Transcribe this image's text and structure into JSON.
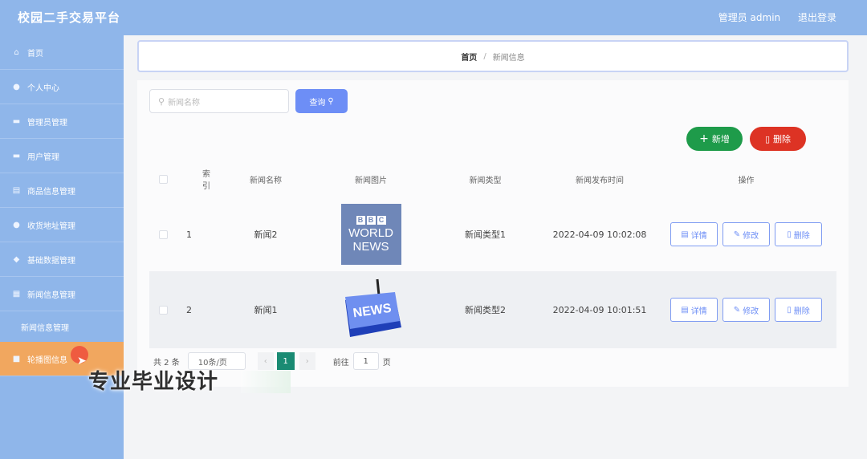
{
  "header": {
    "title": "校园二手交易平台",
    "admin": "管理员 admin",
    "logout": "退出登录"
  },
  "sidebar": {
    "items": [
      {
        "label": "首页",
        "icon": "home-icon"
      },
      {
        "label": "个人中心",
        "icon": "user-icon"
      },
      {
        "label": "管理员管理",
        "icon": "admin-icon"
      },
      {
        "label": "用户管理",
        "icon": "users-icon"
      },
      {
        "label": "商品信息管理",
        "icon": "goods-icon"
      },
      {
        "label": "收货地址管理",
        "icon": "address-icon"
      },
      {
        "label": "基础数据管理",
        "icon": "data-icon"
      },
      {
        "label": "新闻信息管理",
        "icon": "news-icon"
      }
    ],
    "sub_item": "新闻信息管理",
    "active_item": "轮播图信息"
  },
  "breadcrumb": {
    "home": "首页",
    "separator": "/",
    "current": "新闻信息"
  },
  "search": {
    "placeholder": "新闻名称",
    "button": "查询"
  },
  "actions": {
    "add": "新增",
    "delete": "删除"
  },
  "table": {
    "headers": [
      "索引",
      "新闻名称",
      "新闻图片",
      "新闻类型",
      "新闻发布时间",
      "操作"
    ],
    "rows": [
      {
        "index": "1",
        "name": "新闻2",
        "image": "BBC WORLD NEWS",
        "type": "新闻类型1",
        "time": "2022-04-09 10:02:08"
      },
      {
        "index": "2",
        "name": "新闻1",
        "image": "NEWS",
        "type": "新闻类型2",
        "time": "2022-04-09 10:01:51"
      }
    ],
    "row_actions": {
      "detail": "详情",
      "edit": "修改",
      "delete": "删除"
    }
  },
  "pagination": {
    "total": "共 2 条",
    "page_size": "10条/页",
    "current_page": "1",
    "goto_label": "前往",
    "goto_value": "1",
    "page_suffix": "页"
  },
  "watermark": "专业毕业设计",
  "colors": {
    "sidebar": "#8fb6ea",
    "primary": "#6d8ef6",
    "add": "#1e9b4a",
    "delete": "#dd3324",
    "active": "#f1a75f"
  }
}
